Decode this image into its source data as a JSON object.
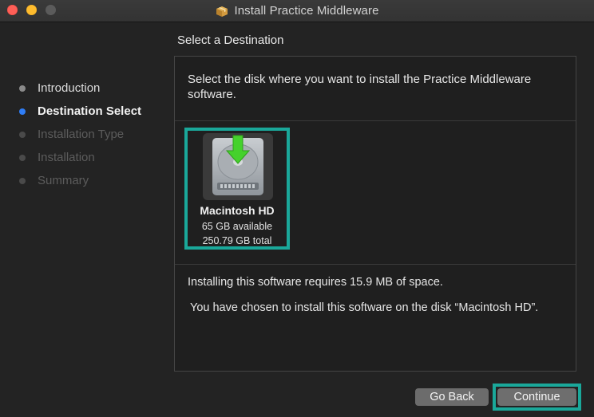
{
  "window": {
    "title": "Install Practice Middleware",
    "title_icon": "package-icon",
    "traffic_lights": {
      "close": "#fe5f57",
      "minimize": "#febc2e",
      "zoom": "#5b5b5b"
    }
  },
  "sidebar": {
    "steps": [
      {
        "label": "Introduction",
        "state": "done"
      },
      {
        "label": "Destination Select",
        "state": "current"
      },
      {
        "label": "Installation Type",
        "state": "todo"
      },
      {
        "label": "Installation",
        "state": "todo"
      },
      {
        "label": "Summary",
        "state": "todo"
      }
    ]
  },
  "main": {
    "heading": "Select a Destination",
    "intro": "Select the disk where you want to install the Practice Middleware software.",
    "disk": {
      "name": "Macintosh HD",
      "available": "65 GB available",
      "total": "250.79 GB total",
      "icon": "hard-drive-icon",
      "selected": true
    },
    "requirement": "Installing this software requires 15.9 MB of space.",
    "chosen": "You have chosen to install this software on the disk “Macintosh HD”."
  },
  "buttons": {
    "back": "Go Back",
    "continue": "Continue"
  },
  "colors": {
    "accent_current_step": "#2f7df6",
    "highlight_frame": "#1aa89a",
    "install_arrow": "#45d12c"
  }
}
